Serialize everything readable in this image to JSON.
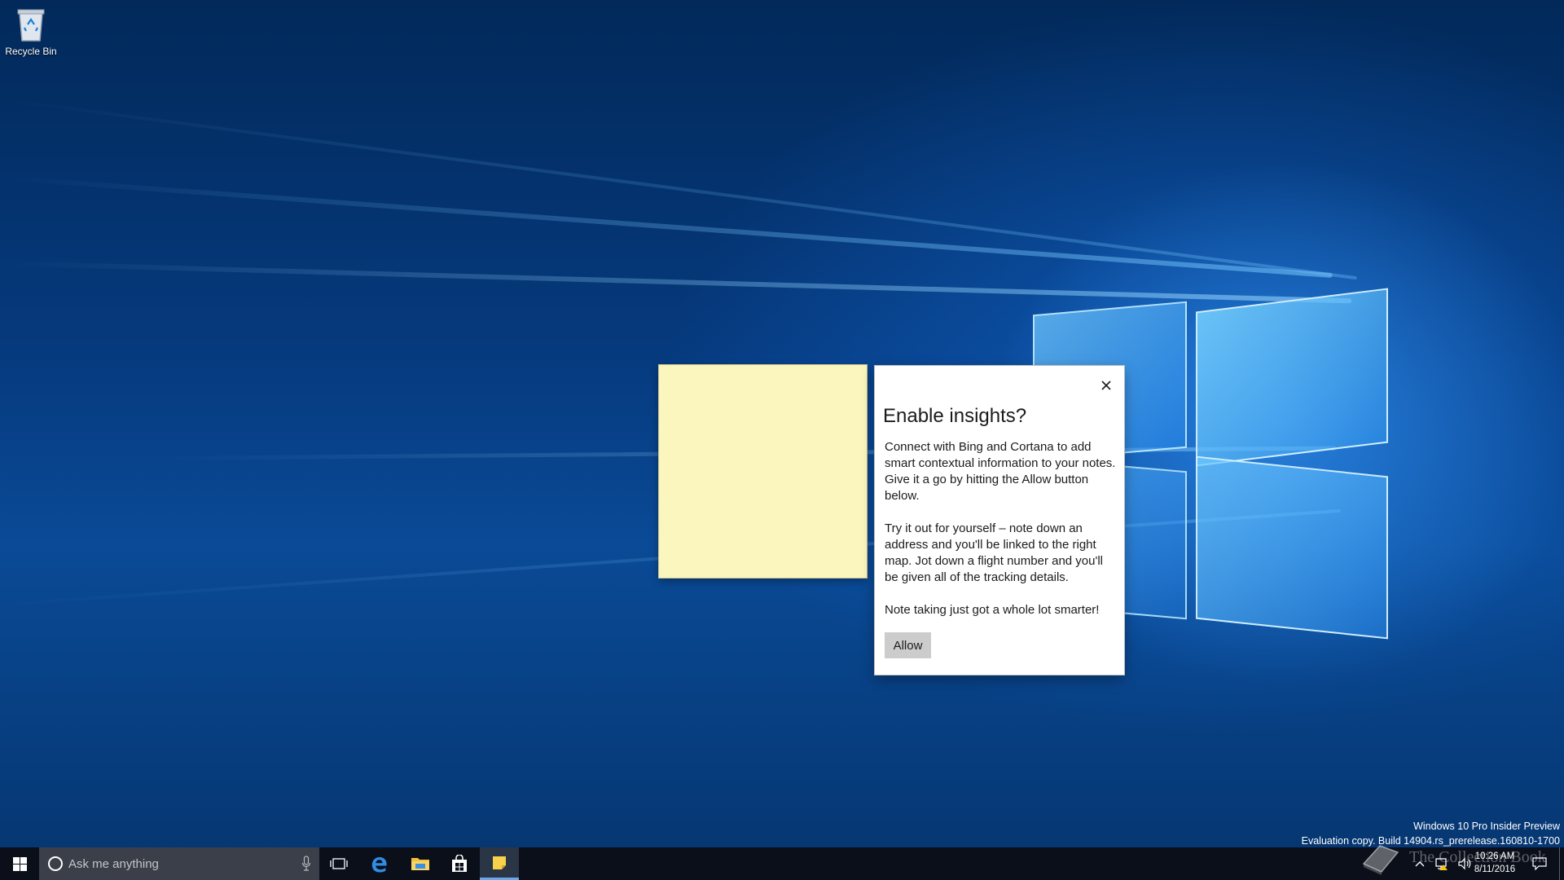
{
  "desktop": {
    "recycle_bin_label": "Recycle Bin",
    "wallpaper": "windows-10-hero"
  },
  "dialog": {
    "title": "Enable insights?",
    "paragraphs": [
      "Connect with Bing and Cortana to add smart contextual information to your notes. Give it a go by hitting the Allow button below.",
      "Try it out for yourself – note down an address and you'll be linked to the right map. Jot down a flight number and you'll be given all of the tracking details.",
      "Note taking just got a whole lot smarter!"
    ],
    "allow_label": "Allow",
    "close_icon": "close-icon"
  },
  "sticky_note": {
    "color": "#fbf5be",
    "text": ""
  },
  "watermark": {
    "line1": "Windows 10 Pro Insider Preview",
    "line2": "Evaluation copy. Build 14904.rs_prerelease.160810-1700"
  },
  "taskbar": {
    "search_placeholder": "Ask me anything",
    "apps": [
      "start-icon",
      "task-view-icon",
      "edge-icon",
      "file-explorer-icon",
      "store-icon",
      "sticky-notes-icon"
    ],
    "clock": {
      "time": "10:26 AM",
      "date": "8/11/2016"
    },
    "brand": "The Collection Book"
  },
  "colors": {
    "taskbar": "#0a0f1a",
    "search_box": "#3a3f4a",
    "accent": "#0078d7"
  }
}
